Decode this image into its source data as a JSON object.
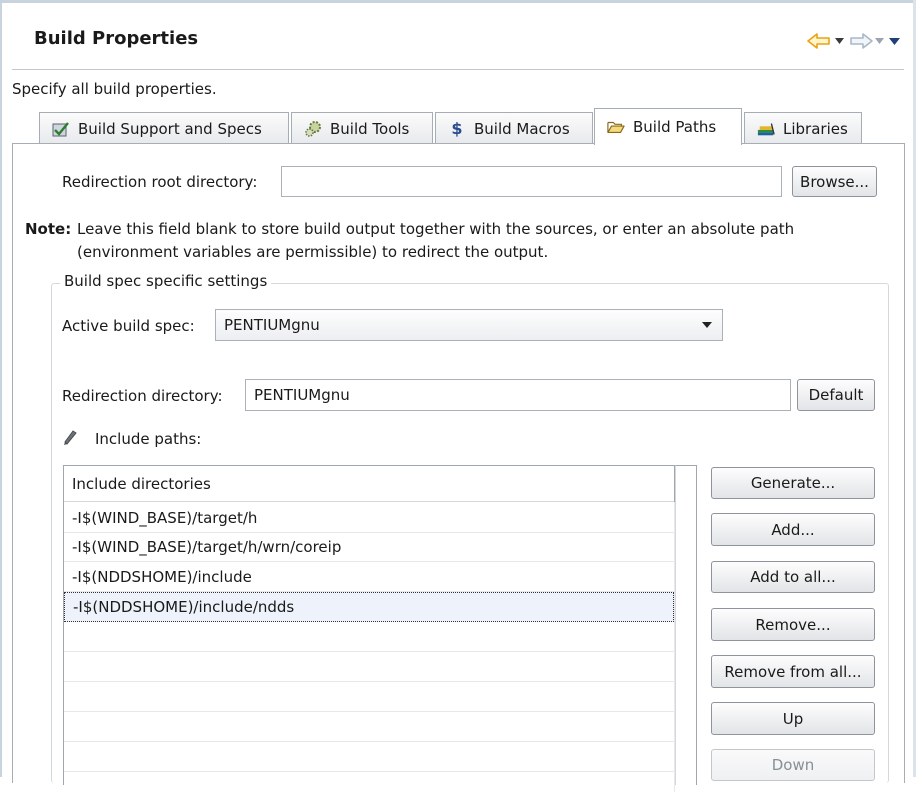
{
  "header": {
    "title": "Build Properties",
    "back_icon": "back-arrow-icon",
    "forward_icon": "forward-arrow-icon",
    "menu_icon": "view-menu-icon"
  },
  "subtitle": "Specify all build properties.",
  "tabs": [
    {
      "label": "Build Support and Specs",
      "icon": "checklist-icon"
    },
    {
      "label": "Build Tools",
      "icon": "gears-icon"
    },
    {
      "label": "Build Macros",
      "icon": "dollar-icon"
    },
    {
      "label": "Build Paths",
      "icon": "folder-open-icon",
      "active": true
    },
    {
      "label": "Libraries",
      "icon": "books-icon"
    }
  ],
  "redirection_root": {
    "label": "Redirection root directory:",
    "value": "",
    "browse_label": "Browse..."
  },
  "note": {
    "prefix": "Note:",
    "line1": "Leave this field blank to store build output together with the sources, or enter an absolute path",
    "line2": "(environment variables are permissible) to redirect the output."
  },
  "group": {
    "label": "Build spec specific settings",
    "active_spec_label": "Active build spec:",
    "active_spec_value": "PENTIUMgnu",
    "redirection_label": "Redirection directory:",
    "redirection_value": "PENTIUMgnu",
    "default_label": "Default",
    "include_paths_label": "Include paths:"
  },
  "include_list": {
    "header": "Include directories",
    "items": [
      "-I$(WIND_BASE)/target/h",
      "-I$(WIND_BASE)/target/h/wrn/coreip",
      "-I$(NDDSHOME)/include",
      "-I$(NDDSHOME)/include/ndds"
    ],
    "selected_index": 3
  },
  "side_buttons": {
    "generate": "Generate...",
    "add": "Add...",
    "add_to_all": "Add to all...",
    "remove": "Remove...",
    "remove_from_all": "Remove from all...",
    "up": "Up",
    "down": "Down"
  },
  "colors": {
    "accent_arrow": "#e8a317",
    "disabled_arrow": "#a9b8c7",
    "menu_arrow": "#1f3f7a"
  }
}
